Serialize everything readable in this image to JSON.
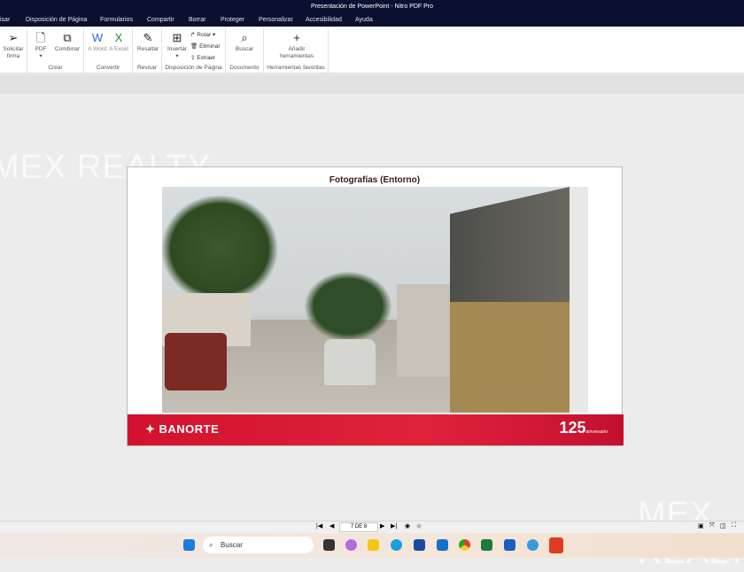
{
  "window": {
    "title": "Presentación de PowerPoint - Nitro PDF Pro"
  },
  "menu": [
    "isar",
    "Disposición de Página",
    "Formularios",
    "Compartir",
    "Borrar",
    "Proteger",
    "Personalizar",
    "Accesibilidad",
    "Ayuda"
  ],
  "ribbon": {
    "solicitar": "Solicitar firma",
    "pdf": "PDF",
    "combinar": "Combinar",
    "crear": "Crear",
    "a_word": "A Word",
    "a_excel": "A Excel",
    "convertir": "Convertir",
    "resaltar": "Resaltar",
    "revisar": "Revisar",
    "insertar": "Insertar",
    "rotar": "Rotar",
    "eliminar": "Eliminar",
    "extraer": "Extraer",
    "disposicion": "Disposición de Página",
    "buscar": "Buscar",
    "documento": "Documento",
    "anadir": "Añadir herramientas",
    "favoritas": "Herramientas favoritas"
  },
  "watermark": "MEX REALTY",
  "slide": {
    "title": "Fotografías (Entorno)",
    "brand": "BANORTE",
    "anniversary": "125",
    "anniversary_sub": "aniversario"
  },
  "nav": {
    "page": "7 DE 8"
  },
  "taskbar": {
    "search_placeholder": "Buscar"
  }
}
